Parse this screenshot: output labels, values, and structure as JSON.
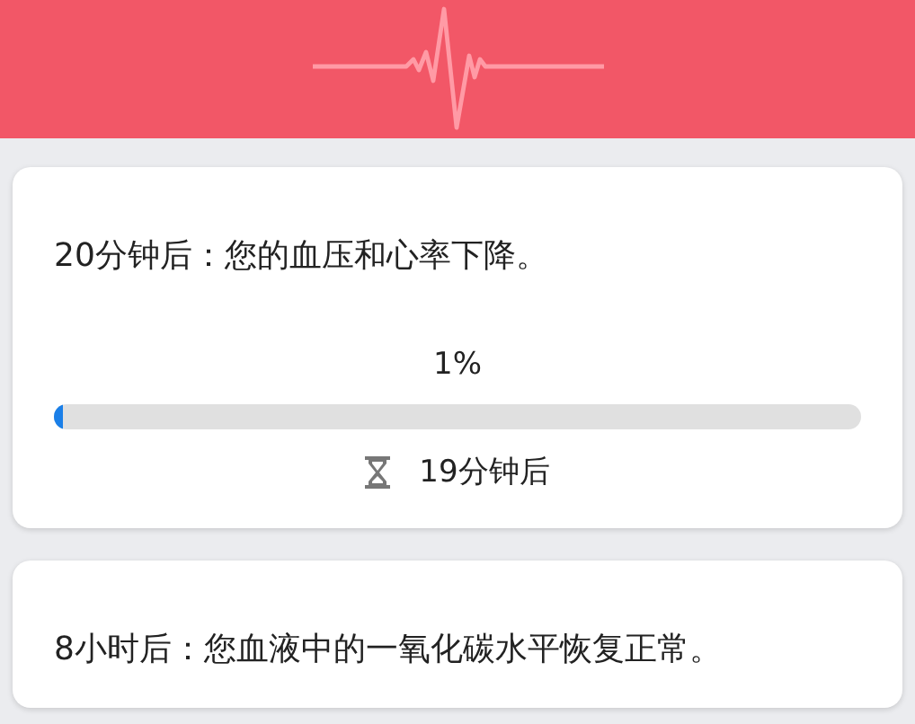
{
  "milestones": [
    {
      "text": "20分钟后：您的血压和心率下降。",
      "percent": "1%",
      "level": 0.01,
      "remaining": "19分钟后"
    },
    {
      "text": "8小时后：您血液中的一氧化碳水平恢复正常。"
    }
  ]
}
